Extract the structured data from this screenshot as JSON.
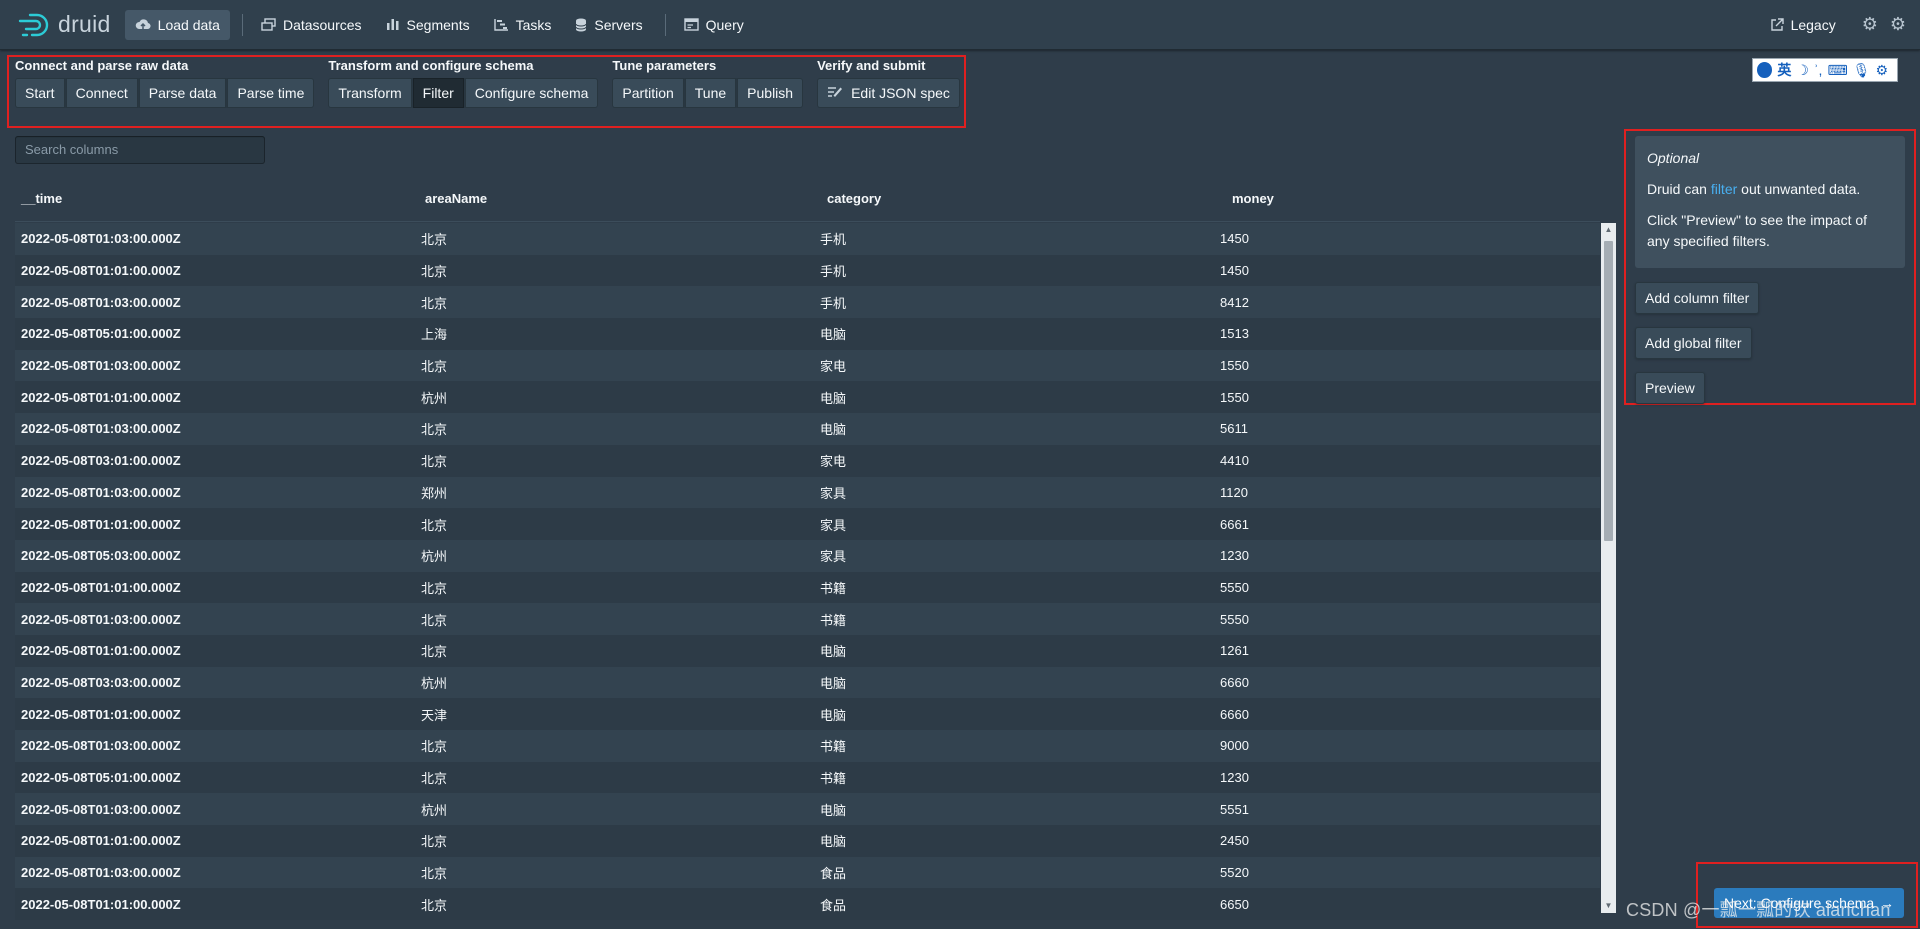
{
  "nav": {
    "logo_text": "druid",
    "items": [
      {
        "label": "Load data",
        "icon": "cloud-upload-icon",
        "active": true
      },
      {
        "label": "Datasources",
        "icon": "multi-select-icon"
      },
      {
        "label": "Segments",
        "icon": "stacked-chart-icon"
      },
      {
        "label": "Tasks",
        "icon": "gantt-chart-icon"
      },
      {
        "label": "Servers",
        "icon": "database-icon"
      },
      {
        "label": "Query",
        "icon": "application-icon"
      }
    ],
    "legacy_label": "Legacy"
  },
  "steps": {
    "groups": [
      {
        "title": "Connect and parse raw data",
        "buttons": [
          "Start",
          "Connect",
          "Parse data",
          "Parse time"
        ]
      },
      {
        "title": "Transform and configure schema",
        "buttons": [
          "Transform",
          "Filter",
          "Configure schema"
        ]
      },
      {
        "title": "Tune parameters",
        "buttons": [
          "Partition",
          "Tune",
          "Publish"
        ]
      },
      {
        "title": "Verify and submit",
        "buttons": [
          "Edit JSON spec"
        ]
      }
    ],
    "active": "Filter"
  },
  "ime": {
    "lang": "英"
  },
  "search": {
    "placeholder": "Search columns"
  },
  "table": {
    "columns": [
      "__time",
      "areaName",
      "category",
      "money"
    ],
    "rows": [
      [
        "2022-05-08T01:03:00.000Z",
        "北京",
        "手机",
        "1450"
      ],
      [
        "2022-05-08T01:01:00.000Z",
        "北京",
        "手机",
        "1450"
      ],
      [
        "2022-05-08T01:03:00.000Z",
        "北京",
        "手机",
        "8412"
      ],
      [
        "2022-05-08T05:01:00.000Z",
        "上海",
        "电脑",
        "1513"
      ],
      [
        "2022-05-08T01:03:00.000Z",
        "北京",
        "家电",
        "1550"
      ],
      [
        "2022-05-08T01:01:00.000Z",
        "杭州",
        "电脑",
        "1550"
      ],
      [
        "2022-05-08T01:03:00.000Z",
        "北京",
        "电脑",
        "5611"
      ],
      [
        "2022-05-08T03:01:00.000Z",
        "北京",
        "家电",
        "4410"
      ],
      [
        "2022-05-08T01:03:00.000Z",
        "郑州",
        "家具",
        "1120"
      ],
      [
        "2022-05-08T01:01:00.000Z",
        "北京",
        "家具",
        "6661"
      ],
      [
        "2022-05-08T05:03:00.000Z",
        "杭州",
        "家具",
        "1230"
      ],
      [
        "2022-05-08T01:01:00.000Z",
        "北京",
        "书籍",
        "5550"
      ],
      [
        "2022-05-08T01:03:00.000Z",
        "北京",
        "书籍",
        "5550"
      ],
      [
        "2022-05-08T01:01:00.000Z",
        "北京",
        "电脑",
        "1261"
      ],
      [
        "2022-05-08T03:03:00.000Z",
        "杭州",
        "电脑",
        "6660"
      ],
      [
        "2022-05-08T01:01:00.000Z",
        "天津",
        "电脑",
        "6660"
      ],
      [
        "2022-05-08T01:03:00.000Z",
        "北京",
        "书籍",
        "9000"
      ],
      [
        "2022-05-08T05:01:00.000Z",
        "北京",
        "书籍",
        "1230"
      ],
      [
        "2022-05-08T01:03:00.000Z",
        "杭州",
        "电脑",
        "5551"
      ],
      [
        "2022-05-08T01:01:00.000Z",
        "北京",
        "电脑",
        "2450"
      ],
      [
        "2022-05-08T01:03:00.000Z",
        "北京",
        "食品",
        "5520"
      ],
      [
        "2022-05-08T01:01:00.000Z",
        "北京",
        "食品",
        "6650"
      ]
    ]
  },
  "panel": {
    "optional": "Optional",
    "line1_pre": "Druid can ",
    "line1_link": "filter",
    "line1_post": " out unwanted data.",
    "line2": "Click \"Preview\" to see the impact of any specified filters.",
    "add_column_filter": "Add column filter",
    "add_global_filter": "Add global filter",
    "preview": "Preview"
  },
  "next_button": {
    "label": "Next: Configure schema"
  },
  "watermark": "CSDN @一瓢一瓢的饮 alanchan",
  "colors": {
    "accent": "#2b7bbd",
    "link": "#48aff0",
    "highlight_box": "#e02020"
  }
}
